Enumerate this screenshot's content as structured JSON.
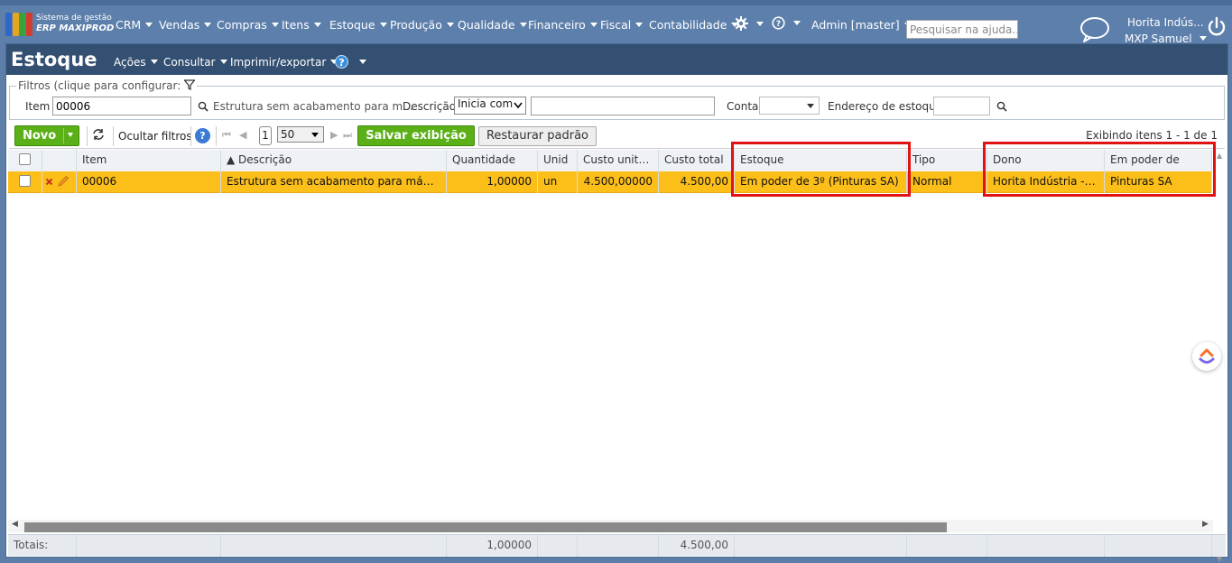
{
  "topnav": {
    "logo_line1": "Sistema de gestão",
    "logo_line2": "ERP MAXIPROD",
    "menus": [
      "CRM",
      "Vendas",
      "Compras",
      "Itens",
      "Estoque",
      "Produção",
      "Qualidade",
      "Financeiro",
      "Fiscal",
      "Contabilidade"
    ],
    "settings_icon": "gear-icon",
    "help_icon": "question-icon",
    "admin_label": "Admin [master]",
    "search_placeholder": "Pesquisar na ajuda...",
    "chat_icon": "chat-bubble-icon",
    "company": "Horita Indús...",
    "user": "MXP Samuel",
    "power_icon": "power-icon"
  },
  "subheader": {
    "title": "Estoque",
    "menus": [
      "Ações",
      "Consultar",
      "Imprimir/exportar"
    ],
    "help_icon": "question-icon"
  },
  "filters": {
    "legend": "Filtros (clique para configurar:",
    "item_label": "Item",
    "item_value": "00006",
    "item_description": "Estrutura sem acabamento para m...",
    "description_label": "Descrição",
    "description_mode": "Inicia com",
    "description_value": "",
    "account_label": "Conta",
    "account_value": "",
    "address_label": "Endereço de estoque",
    "address_value": ""
  },
  "toolbar": {
    "new_label": "Novo",
    "hide_filters_label": "Ocultar filtros",
    "page": "1",
    "page_size": "50",
    "save_view_label": "Salvar exibição",
    "restore_default_label": "Restaurar padrão",
    "showing_label": "Exibindo itens 1 - 1 de 1"
  },
  "grid": {
    "columns": [
      "Item",
      "▲ Descrição",
      "Quantidade",
      "Unid",
      "Custo unitário",
      "Custo total",
      "Estoque",
      "Tipo",
      "Dono",
      "Em poder de"
    ],
    "rows": [
      {
        "item": "00006",
        "descricao": "Estrutura sem acabamento para máquina ...",
        "quantidade": "1,00000",
        "unid": "un",
        "custo_unitario": "4.500,00000",
        "custo_total": "4.500,00",
        "estoque": "Em poder de 3º (Pinturas SA)",
        "tipo": "Normal",
        "dono": "Horita Indústria - H...",
        "em_poder_de": "Pinturas SA"
      }
    ],
    "totals_label": "Totais:",
    "totals_quantidade": "1,00000",
    "totals_custo_total": "4.500,00"
  },
  "colors": {
    "topbar": "#5c7fab",
    "subheader": "#334f71",
    "selected_row": "#fcbf1a",
    "green_button": "#5bb017",
    "highlight": "#e01212"
  }
}
